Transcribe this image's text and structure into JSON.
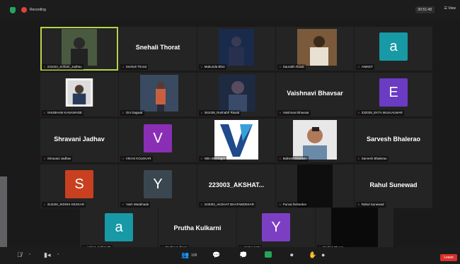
{
  "topbar": {
    "recording": "Recording",
    "timer": "00:51:48",
    "view": "View"
  },
  "tiles": [
    {
      "label": "231023_Soham_Jadhav"
    },
    {
      "name": "Snehali Thorat",
      "label": "Snehali Thorat"
    },
    {
      "label": "Mukunda Bhoi"
    },
    {
      "label": "Saurabh Rasal"
    },
    {
      "avatar": "a",
      "avatar_color": "#1799a6",
      "label": "ANIKET"
    },
    {
      "label": "SHUBHAM KANAWADE"
    },
    {
      "label": "Om Dagwar"
    },
    {
      "label": "361038_Rushabh Rawal"
    },
    {
      "name": "Vaishnavi Bhavsar",
      "label": "Vaishnavi Bhavsar"
    },
    {
      "avatar": "E",
      "avatar_color": "#6b3bc4",
      "label": "332039_EKTA MULKALWAR"
    },
    {
      "name": "Shravani Jadhav",
      "label": "Shravani Jadhav"
    },
    {
      "avatar": "V",
      "avatar_color": "#8a2fb5",
      "label": "VIKAS KOLEKAR"
    },
    {
      "label": "Nitin Bhirsagar"
    },
    {
      "label": "Mahesh Dandale"
    },
    {
      "name": "Sarvesh Bhalerao",
      "label": "Sarvesh Bhalerao"
    },
    {
      "avatar": "S",
      "avatar_color": "#c8401f",
      "label": "312028_SIDDHI KESKAR"
    },
    {
      "avatar": "Y",
      "avatar_color": "#3a4750",
      "label": "Yash Wankhade"
    },
    {
      "name": "223003_AKSHAT...",
      "label": "223003_AKSHAT BHATAWDEKAR"
    },
    {
      "label": "Purvai Rohankar"
    },
    {
      "name": "Rahul Sunewad",
      "label": "Rahul Sunewad"
    },
    {
      "avatar": "a",
      "avatar_color": "#1799a6",
      "label": "Aniket_Kalbmath"
    },
    {
      "name": "Prutha Kulkarni",
      "label": "Prutha Kulkarni"
    },
    {
      "avatar": "Y",
      "avatar_color": "#7c3fc4",
      "label": "YASH JAIN"
    },
    {
      "label": "Snehali Thorat"
    }
  ],
  "bottombar": {
    "participants_count": "109",
    "leave": "Leave"
  }
}
